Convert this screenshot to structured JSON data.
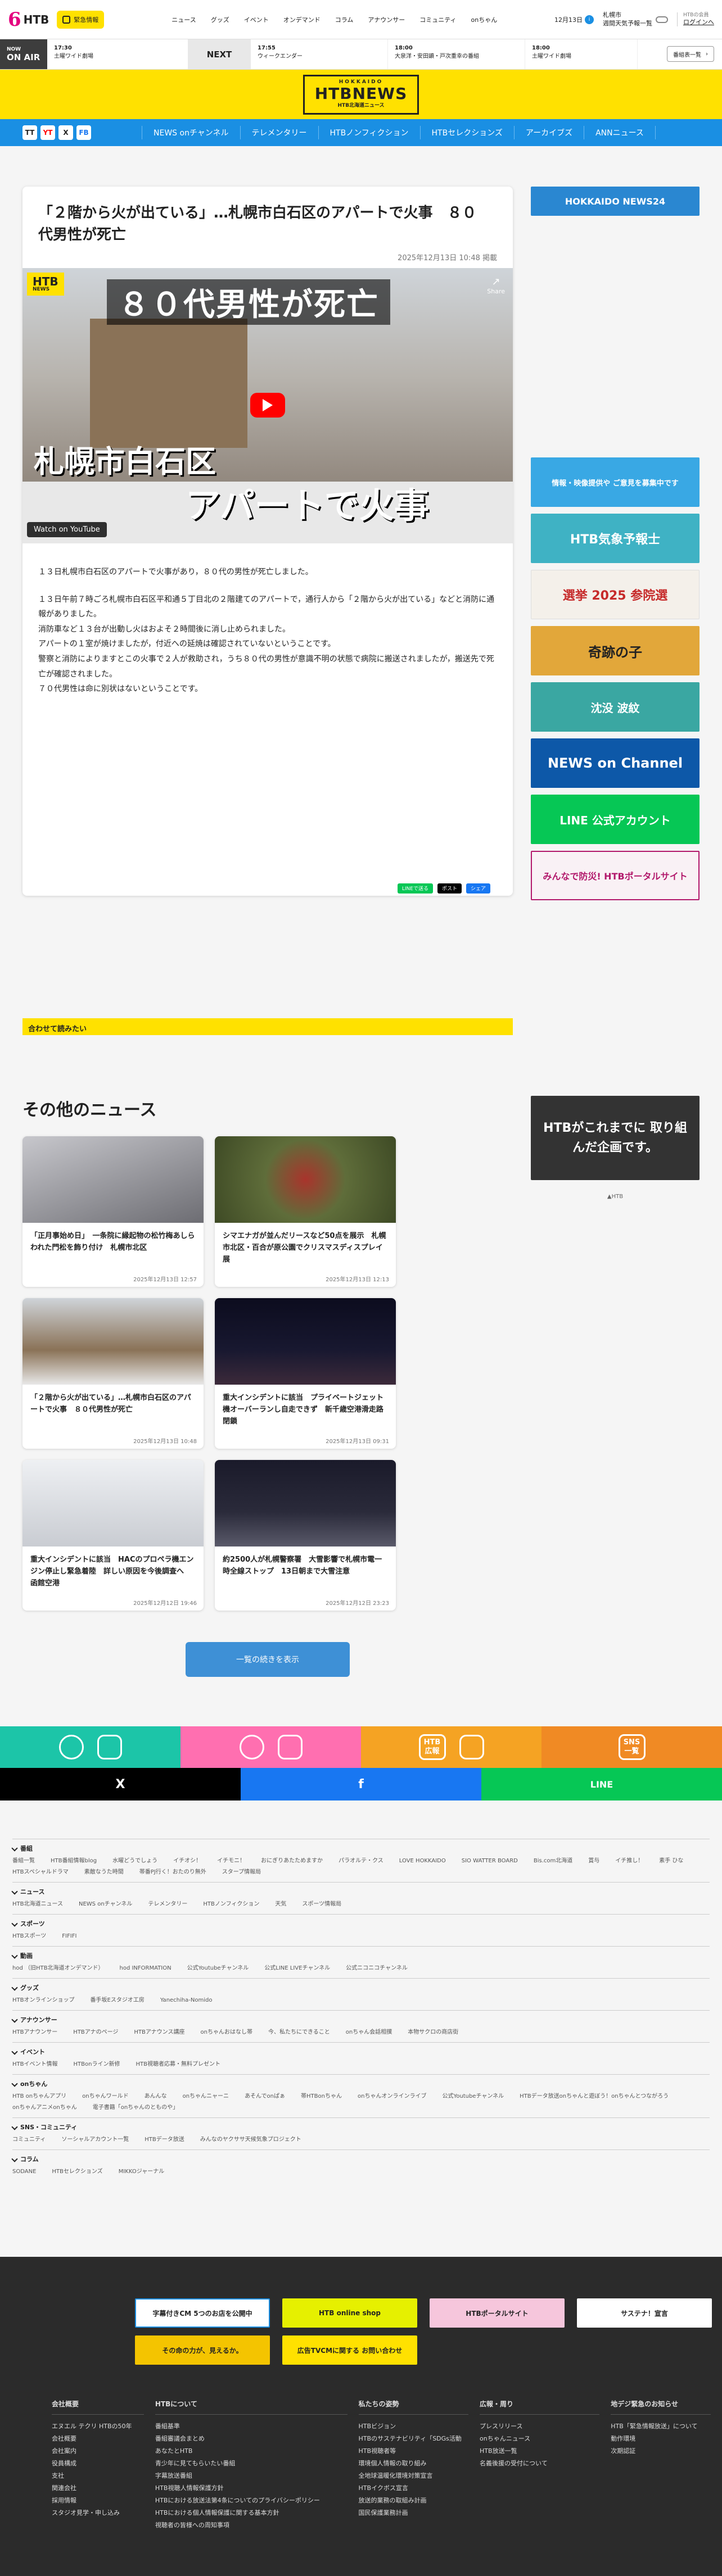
{
  "header": {
    "logo_num": "6",
    "logo_text": "HTB",
    "disaster_label": "緊急情報",
    "nav": [
      "ニュース",
      "グッズ",
      "イベント",
      "オンデマンド",
      "コラム",
      "アナウンサー",
      "コミュニティ",
      "onちゃん"
    ],
    "date": "12月13日",
    "date_badge": "i",
    "weather_place": "札幌市",
    "weather_text": "週間天気予報一覧",
    "login_top": "HTBの会員",
    "login_name": "ログインへ"
  },
  "onair": {
    "now_label": "NOW",
    "onair_label": "ON AIR",
    "now_time": "17:30",
    "now_title": "土曜ワイド劇場",
    "next_label": "NEXT",
    "programs": [
      {
        "time": "17:55",
        "title": "ウィークエンダー"
      },
      {
        "time": "18:00",
        "title": "大泉洋・安田顕・戸次重幸の番組"
      },
      {
        "time": "18:00",
        "title": "土曜ワイド劇場"
      }
    ],
    "tv_button": "番組表一覧"
  },
  "brand": {
    "top": "HOKKAIDO",
    "sub": "HTB北海道ニュース",
    "name": "HTBNEWS"
  },
  "bluenav": [
    "NEWS onチャンネル",
    "テレメンタリー",
    "HTBノンフィクション",
    "HTBセレクションズ",
    "アーカイブズ",
    "ANNニュース"
  ],
  "socials": [
    "TT",
    "YT",
    "X",
    "FB"
  ],
  "article": {
    "title": "「２階から火が出ている」…札幌市白石区のアパートで火事　８０代男性が死亡",
    "date": "2025年12月13日 10:48 掲載",
    "video_banner": "８０代男性が死亡",
    "video_caption1": "札幌市白石区",
    "video_caption2": "アパートで火事",
    "video_watch": "Watch on YouTube",
    "video_logo": "HTB",
    "video_logo_sub": "NEWS",
    "video_share": "Share",
    "paragraphs": [
      "１３日札幌市白石区のアパートで火事があり，８０代の男性が死亡しました。",
      "１３日午前７時ごろ札幌市白石区平和通５丁目北の２階建てのアパートで，通行人から「２階から火が出ている」などと消防に通報がありました。",
      "消防車など１３台が出動し火はおよそ２時間後に消し止められました。",
      "アパートの１室が焼けましたが，付近への延焼は確認されていないということです。",
      "警察と消防によりますとこの火事で２人が救助され，うち８０代の男性が意識不明の状態で病院に搬送されましたが，搬送先で死亡が確認されました。",
      "７０代男性は命に別状はないということです。"
    ],
    "share_line": "LINEで送る",
    "share_x": "ポスト",
    "share_fb": "シェア"
  },
  "sidebar": {
    "ads": [
      {
        "label": "HOKKAIDO NEWS24",
        "color": "#2a87d1"
      },
      {
        "label": "情報・映像提供や ご意見を募集中です",
        "color": "#39a8e4"
      },
      {
        "label": "HTB気象予報士",
        "color": "#3fb2c4"
      },
      {
        "label": "選挙 2025 参院選",
        "color": "#f4f0ea"
      },
      {
        "label": "奇跡の子",
        "color": "#e2a73a"
      },
      {
        "label": "沈没 波紋",
        "color": "#3aa7a2"
      },
      {
        "label": "NEWS on Channel",
        "color": "#0d58a8"
      },
      {
        "label": "LINE 公式アカウント",
        "color": "#06c755"
      },
      {
        "label": "みんなで防災! HTBポータルサイト",
        "color": "#f9f1f5"
      }
    ]
  },
  "related": {
    "title": "合わせて読みたい"
  },
  "others": {
    "title": "その他のニュース",
    "items": [
      {
        "title": "「正月事始め日」　一条院に縁起物の松竹梅あしらわれた門松を飾り付け　札幌市北区",
        "date": "2025年12月13日 12:57",
        "color": "#9b9ba0"
      },
      {
        "title": "シマエナガが並んだリースなど50点を展示　札幌市北区・百合が原公園でクリスマスディスプレイ展",
        "date": "2025年12月13日 12:13",
        "color": "#5f6d3a"
      },
      {
        "title": "「２階から火が出ている」…札幌市白石区のアパートで火事　８０代男性が死亡",
        "date": "2025年12月13日 10:48",
        "color": "#8a7257"
      },
      {
        "title": "重大インシデントに該当　プライベートジェット機オーバーランし自走できず　新千歳空港滑走路閉鎖",
        "date": "2025年12月13日 09:31",
        "color": "#181830"
      },
      {
        "title": "重大インシデントに該当　HACのプロペラ機エンジン停止し緊急着陸　詳しい原因を今後調査へ　函館空港",
        "date": "2025年12月12日 19:46",
        "color": "#d9dbe0"
      },
      {
        "title": "約2500人が札幌警察署　大雪影響で札幌市電一時全線ストップ　13日朝まで大雪注意",
        "date": "2025年12月12日 23:23",
        "color": "#2a2a3a"
      }
    ],
    "more_button": "一覧の続きを表示",
    "side_banner": "HTBがこれまでに 取り組んだ企画です。",
    "side_link": "▲HTB"
  },
  "band": [
    {
      "label": "",
      "color": "#1cc5a8"
    },
    {
      "label": "",
      "color": "#ff6fb0"
    },
    {
      "label": "HTB広報",
      "color": "#f5a323"
    },
    {
      "label": "SNS一覧",
      "color": "#f08a24"
    }
  ],
  "sharebar": [
    {
      "label": "X",
      "color": "#000000"
    },
    {
      "label": "f",
      "color": "#1877f2"
    },
    {
      "label": "LINE",
      "color": "#06c755"
    }
  ],
  "sitemap": [
    {
      "title": "番組",
      "links": [
        "番組一覧",
        "HTB番組情報blog",
        "水曜どうでしょう",
        "イチオシ！",
        "イチモニ！",
        "おにぎりあたためますか",
        "パラオルテ・クス",
        "LOVE HOKKAIDO",
        "SIO WATTER BOARD",
        "Bis.com北海道",
        "賞与",
        "イチ推し！",
        "素手 ひな",
        "HTBスペシャルドラマ",
        "素敵なうた時間",
        "帯番PJ行く！おたのり無外",
        "スタープ情報局"
      ]
    },
    {
      "title": "ニュース",
      "links": [
        "HTB北海道ニュース",
        "NEWS onチャンネル",
        "テレメンタリー",
        "HTBノンフィクション",
        "天気",
        "スポーツ情報局"
      ]
    },
    {
      "title": "スポーツ",
      "links": [
        "HTBスポーツ",
        "FIFIFI"
      ]
    },
    {
      "title": "動画",
      "links": [
        "hod （旧HTB北海道オンデマンド）",
        "hod INFORMATION",
        "公式Youtubeチャンネル",
        "公式LINE LIVEチャンネル",
        "公式ニコニコチャンネル"
      ]
    },
    {
      "title": "グッズ",
      "links": [
        "HTBオンラインショップ",
        "番手坂Eスタジオ工房",
        "Yanechiha-Nomido"
      ]
    },
    {
      "title": "アナウンサー",
      "links": [
        "HTBアナウンサー",
        "HTBアナのページ",
        "HTBアナウンス講座",
        "onちゃんおはなし帯",
        "今、私たちにできること",
        "onちゃん会話相撲",
        "本物サクロの商店街"
      ]
    },
    {
      "title": "イベント",
      "links": [
        "HTBイベント情報",
        "HTBonライン新修",
        "HTB視聴者応募・無料プレゼント"
      ]
    },
    {
      "title": "onちゃん",
      "links": [
        "HTB onちゃんアプリ",
        "onちゃんワールド",
        "あんんな",
        "onちゃんニャーニ",
        "あそんでonぱぁ",
        "帯HTBonちゃん",
        "onちゃんオンラインライブ",
        "公式Youtubeチャンネル",
        "HTBデータ放送onちゃんと遊ぼう！onちゃんとつながろう",
        "onちゃんアニメonちゃん",
        "電子書籍「onちゃんのとものや」"
      ]
    },
    {
      "title": "SNS・コミュニティ",
      "links": [
        "コミュニティ",
        "ソーシャルアカウント一覧",
        "HTBデータ放送",
        "みんなのヤクササ天候気象プロジェクト"
      ]
    },
    {
      "title": "コラム",
      "links": [
        "SODANE",
        "HTBセレクションズ",
        "MIKKOジャーナル"
      ]
    }
  ],
  "footer": {
    "banners_row1": [
      {
        "label": "字幕付きCM 5つのお店を公開中",
        "color": "#ffffff"
      },
      {
        "label": "HTB online shop",
        "color": "#e6f000"
      },
      {
        "label": "HTBポータルサイト",
        "color": "#f6c6dc"
      },
      {
        "label": "サステナ！宣言",
        "color": "#ffffff"
      }
    ],
    "banners_row2": [
      {
        "label": "その命の力が、見えるか。",
        "color": "#f4c400"
      },
      {
        "label": "広告TVCMに関する お問い合わせ",
        "color": "#ffe100"
      }
    ],
    "cols": [
      {
        "title": "会社概要",
        "items": [
          "エヌエル テクリ HTBの50年",
          "会社概要",
          "会社案内",
          "役員構成",
          "支社",
          "関連会社",
          "採用情報",
          "スタジオ見学・申し込み"
        ]
      },
      {
        "title": "HTBについて",
        "items": [
          "番組基準",
          "番組審議会まとめ",
          "あなたとHTB",
          "青少年に見てもらいたい番組",
          "字幕放送番組",
          "HTB視聴人情報保護方針",
          "HTBにおける放送法第4条についてのプライバシーポリシー",
          "HTBにおける個人情報保護に関する基本方針",
          "視聴者の皆様への周知事項"
        ]
      },
      {
        "title": "私たちの姿勢",
        "items": [
          "HTBビジョン",
          "HTBのサステナビリティ「SDGs活動",
          "HTB視聴者等",
          "環境個人情報の取り組み",
          "全地球温暖化環境対策宣言",
          "HTBイクボス宣言",
          "放送的業務の取組み計画",
          "国民保護業務計画"
        ]
      },
      {
        "title": "広報・周り",
        "items": [
          "プレスリリース",
          "onちゃんニュース",
          "HTB放送一覧",
          "名義後援の受付について"
        ]
      },
      {
        "title": "地デジ緊急のお知らせ",
        "items": [
          "HTB「緊急情報放送」について",
          "動作環境",
          "次期認証"
        ]
      }
    ]
  }
}
